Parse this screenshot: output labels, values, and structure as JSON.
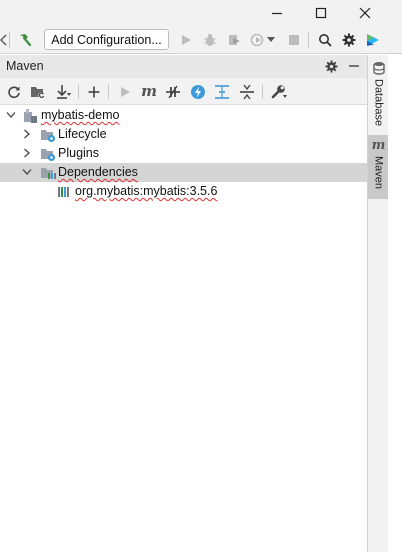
{
  "window": {
    "controls": [
      {
        "name": "minimize-icon"
      },
      {
        "name": "maximize-icon"
      },
      {
        "name": "close-icon"
      }
    ]
  },
  "run_toolbar": {
    "build_icon": "hammer-icon",
    "add_configuration_label": "Add Configuration...",
    "icons": [
      "run-icon",
      "debug-icon",
      "coverage-icon",
      "profile-icon",
      "dropdown-icon",
      "stop-icon",
      "search-icon",
      "settings-icon",
      "toolbox-icon"
    ]
  },
  "maven_panel": {
    "title": "Maven",
    "header_icons": [
      "gear-icon",
      "minimize-panel-icon"
    ],
    "toolbar_icons": [
      "reload-icon",
      "generate-sources-icon",
      "download-icon",
      "add-icon",
      "run-maven-icon",
      "execute-goal-icon",
      "toggle-offline-icon",
      "skip-tests-icon",
      "show-dependencies-icon",
      "collapse-all-icon",
      "settings-wrench-icon"
    ],
    "tree": [
      {
        "label": "mybatis-demo",
        "level": 0,
        "expanded": true,
        "icon": "maven-project-icon"
      },
      {
        "label": "Lifecycle",
        "level": 1,
        "expanded": false,
        "icon": "folder-gear-icon"
      },
      {
        "label": "Plugins",
        "level": 1,
        "expanded": false,
        "icon": "folder-gear-icon"
      },
      {
        "label": "Dependencies",
        "level": 1,
        "expanded": true,
        "icon": "dependencies-folder-icon",
        "selected": true
      },
      {
        "label": "org.mybatis:mybatis:3.5.6",
        "level": 2,
        "icon": "library-icon"
      }
    ]
  },
  "side_stripe": {
    "tabs": [
      {
        "label": "Database",
        "icon": "database-icon",
        "active": false
      },
      {
        "label": "Maven",
        "icon": "maven-m-icon",
        "active": true
      }
    ]
  },
  "colors": {
    "toolbar_bg": "#f2f2f2",
    "header_bg": "#e8e8e8",
    "selection_bg": "#d5d5d5",
    "spell_underline": "#e03131",
    "accent_green": "#3d8f3d",
    "accent_blue": "#3d9bd8"
  }
}
